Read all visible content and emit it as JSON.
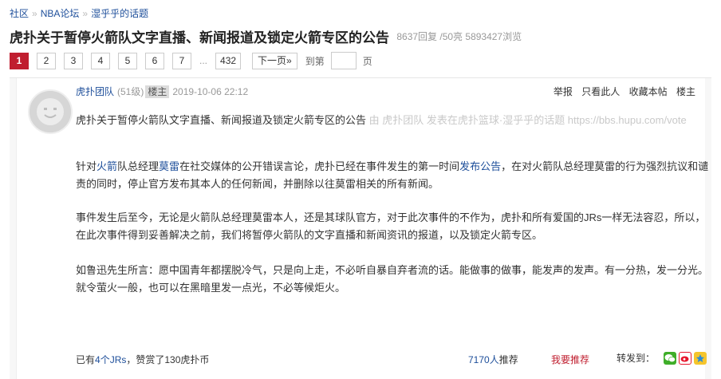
{
  "breadcrumb": {
    "items": [
      "社区",
      "NBA论坛",
      "湿乎乎的话题"
    ],
    "separator": "»"
  },
  "thread": {
    "title": "虎扑关于暂停火箭队文字直播、新闻报道及锁定火箭专区的公告",
    "stats": "8637回复 /50亮  5893427浏览"
  },
  "pagination": {
    "pages": [
      "1",
      "2",
      "3",
      "4",
      "5",
      "6",
      "7"
    ],
    "ellipsis": "...",
    "last": "432",
    "next_label": "下一页»",
    "goto_label": "到第",
    "goto_suffix": "页"
  },
  "post": {
    "author": "虎扑团队",
    "level": "(51级)",
    "owner_tag": "楼主",
    "time": "2019-10-06 22:12",
    "actions": [
      "举报",
      "只看此人",
      "收藏本帖",
      "楼主"
    ],
    "quote_title": "虎扑关于暂停火箭队文字直播、新闻报道及锁定火箭专区的公告",
    "quote_source": "由  虎扑团队 发表在虎扑篮球·湿乎乎的话题 https://bbs.hupu.com/vote",
    "para1": {
      "a": "针对",
      "k1": "火箭",
      "b": "队总经理",
      "k2": "莫雷",
      "c": "在社交媒体的公开错误言论，虎扑已经在事件发生的第一时间",
      "k3": "发布公告",
      "d": "，在对火箭队总经理莫雷的行为强烈抗议和谴责的同时，停止官方发布其本人的任何新闻，并删除以往莫雷相关的所有新闻。"
    },
    "para2": "事件发生后至今，无论是火箭队总经理莫雷本人，还是其球队官方，对于此次事件的不作为，虎扑和所有爱国的JRs一样无法容忍，所以，在此次事件得到妥善解决之前，我们将暂停火箭队的文字直播和新闻资讯的报道，以及锁定火箭专区。",
    "para3": "如鲁迅先生所言：愿中国青年都摆脱冷气，只是向上走，不必听自暴自弃者流的话。能做事的做事，能发声的发声。有一分热，发一分光。就令萤火一般，也可以在黑暗里发一点光，不必等候炬火。",
    "footer": {
      "pre": "已有",
      "jrs": "4个JRs",
      "post": "，赞赏了130虎扑币"
    },
    "recommend_count": "7170人",
    "recommend_suffix": "推荐",
    "i_recommend": "我要推荐",
    "share_label": "转发到：",
    "share_icons": [
      "wechat-icon",
      "weibo-icon",
      "qzone-icon"
    ]
  },
  "colors": {
    "accent": "#c01e2f",
    "link": "#1d4e9a"
  }
}
